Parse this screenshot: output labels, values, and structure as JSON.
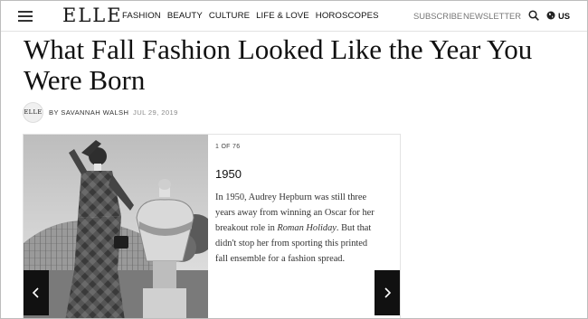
{
  "header": {
    "logo": "ELLE",
    "nav": [
      "FASHION",
      "BEAUTY",
      "CULTURE",
      "LIFE & LOVE",
      "HOROSCOPES"
    ],
    "subscribe": "SUBSCRIBE",
    "newsletter": "NEWSLETTER",
    "locale": "US"
  },
  "article": {
    "title": "What Fall Fashion Looked Like the Year You Were Born",
    "avatar_text": "ELLE",
    "author": "BY SAVANNAH WALSH",
    "date": "JUL 29, 2019"
  },
  "slide": {
    "counter": "1 OF 76",
    "year": "1950",
    "caption_1": "In 1950, Audrey Hepburn was still three years away from winning an Oscar for her breakout role in ",
    "caption_em": "Roman Holiday",
    "caption_2": ". But that didn't stop her from sporting this printed fall ensemble for a fashion spread."
  },
  "icons": {
    "menu": "hamburger-icon",
    "search": "search-icon",
    "globe": "globe-icon",
    "prev": "chevron-left-icon",
    "next": "chevron-right-icon"
  }
}
